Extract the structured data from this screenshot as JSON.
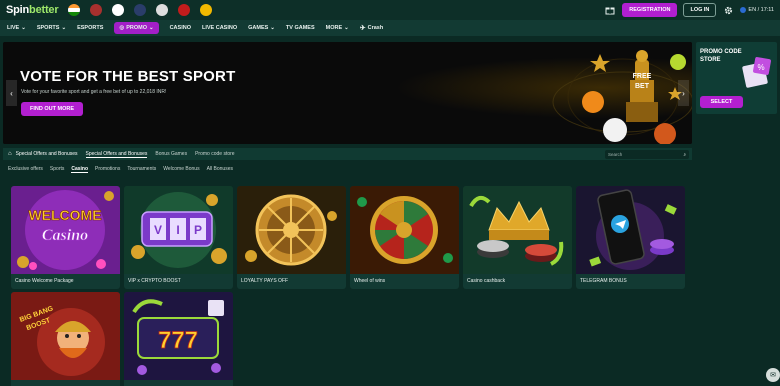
{
  "header": {
    "logo_main": "Spin",
    "logo_accent": "better",
    "registration_label": "REGISTRATION",
    "login_label": "LOG IN",
    "lang_time": "EN / 17:11"
  },
  "nav": {
    "items": [
      {
        "label": "LIVE"
      },
      {
        "label": "SPORTS"
      },
      {
        "label": "ESPORTS"
      },
      {
        "label": "PROMO"
      },
      {
        "label": "CASINO"
      },
      {
        "label": "LIVE CASINO"
      },
      {
        "label": "GAMES"
      },
      {
        "label": "TV GAMES"
      },
      {
        "label": "MORE"
      },
      {
        "label": "Crash"
      }
    ]
  },
  "hero": {
    "title": "VOTE FOR THE BEST SPORT",
    "subtitle": "Vote for your favorite sport and get a free bet of up to 22,018 INR!",
    "button": "FIND OUT MORE",
    "trophy_text": "FREE BET"
  },
  "side_promo": {
    "title": "PROMO CODE STORE",
    "button": "SELECT"
  },
  "breadcrumb": {
    "items": [
      {
        "label": "Special Offers and Bonuses"
      },
      {
        "label": "Special Offers and Bonuses"
      },
      {
        "label": "Bonus Games"
      },
      {
        "label": "Promo code store"
      }
    ],
    "search_placeholder": "Search"
  },
  "tabs": [
    {
      "label": "Exclusive offers"
    },
    {
      "label": "Sports"
    },
    {
      "label": "Casino"
    },
    {
      "label": "Promotions"
    },
    {
      "label": "Tournaments"
    },
    {
      "label": "Welcome Bonus"
    },
    {
      "label": "All Bonuses"
    }
  ],
  "cards": [
    {
      "caption": "Casino Welcome Package",
      "art_text": "WELCOME Casino"
    },
    {
      "caption": "VIP x CRYPTO BOOST",
      "art_text": "VIP"
    },
    {
      "caption": "LOYALTY PAYS OFF",
      "art_text": ""
    },
    {
      "caption": "Wheel of wins",
      "art_text": ""
    },
    {
      "caption": "Casino cashback",
      "art_text": ""
    },
    {
      "caption": "TELEGRAM BONUS",
      "art_text": ""
    },
    {
      "caption": "",
      "art_text": "BIG BANG BOOST"
    },
    {
      "caption": "",
      "art_text": "777"
    }
  ]
}
